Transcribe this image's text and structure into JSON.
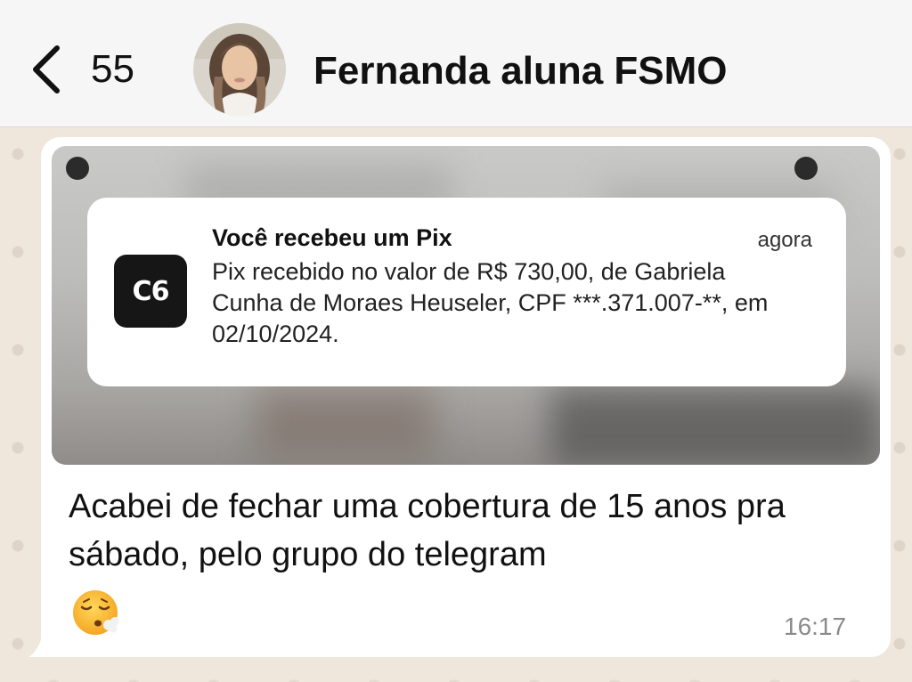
{
  "header": {
    "back_count": "55",
    "contact_name": "Fernanda aluna FSMO"
  },
  "message": {
    "notification": {
      "app_icon_text": "C6",
      "title": "Você recebeu um Pix",
      "time": "agora",
      "body": "Pix recebido no valor de R$ 730,00, de Gabriela Cunha de Moraes Heuseler, CPF ***.371.007-**, em 02/10/2024."
    },
    "text": "Acabei de fechar uma cobertura de 15 anos pra sábado, pelo grupo do telegram",
    "emoji": "face-exhaling-emoji",
    "time": "16:17"
  },
  "colors": {
    "header_bg": "#f6f6f6",
    "chat_bg": "#efe7dc",
    "bubble_bg": "#ffffff",
    "timestamp": "#8a8a8a"
  }
}
